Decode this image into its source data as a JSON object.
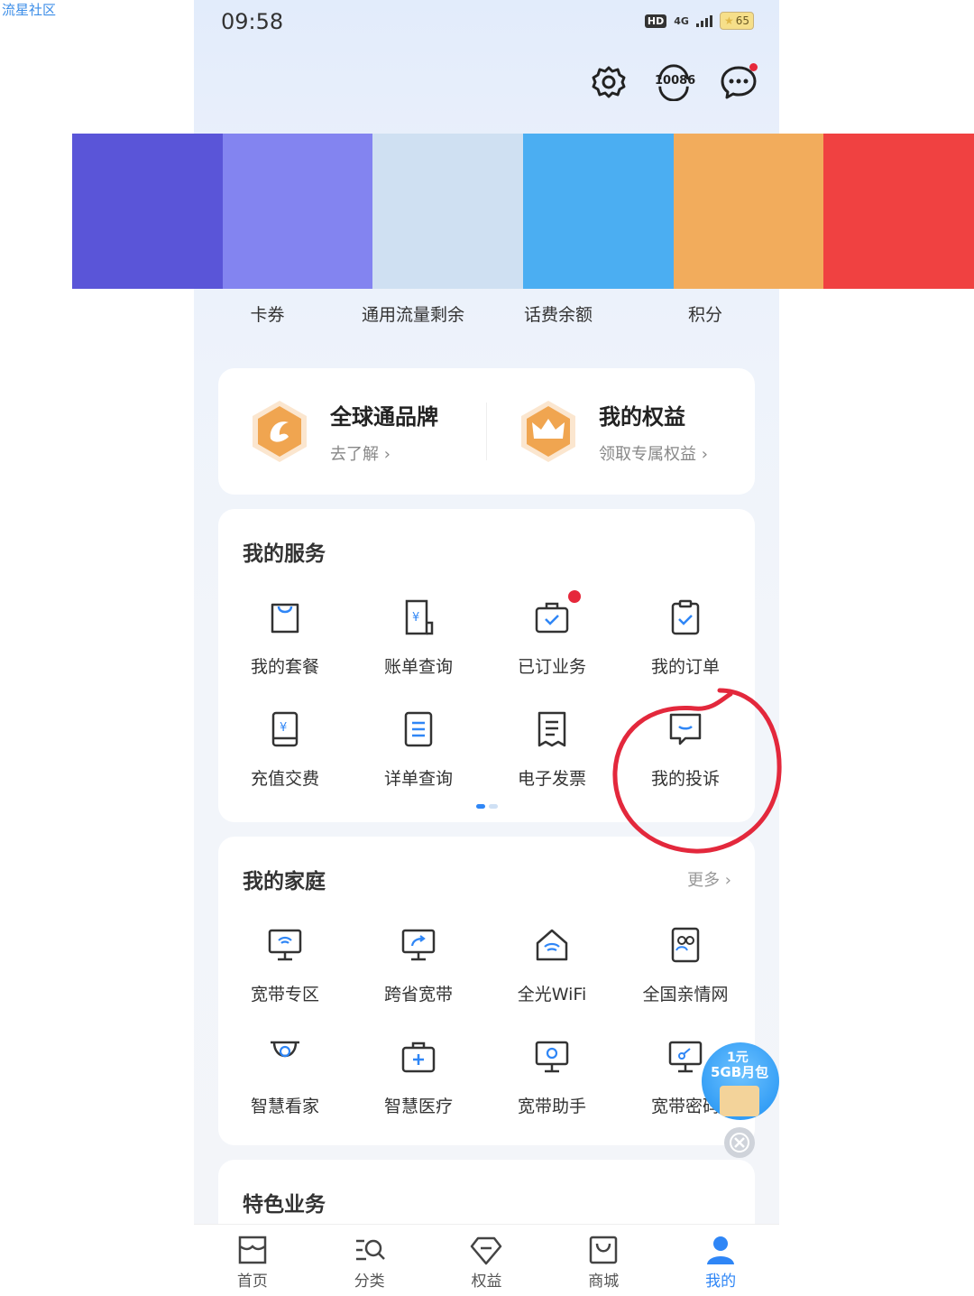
{
  "watermark": "流星社区",
  "status": {
    "time": "09:58",
    "hd": "HD",
    "network": "4G",
    "battery": "65"
  },
  "header_icons": [
    "gear-icon",
    "hotline-10086-icon",
    "message-icon"
  ],
  "hotline_number": "10086",
  "color_swatches": [
    "#5a55d8",
    "#8384f0",
    "#cfe0f2",
    "#4baef2",
    "#f2ac5c",
    "#f04141"
  ],
  "stats": [
    "卡券",
    "通用流量剩余",
    "话费余额",
    "积分"
  ],
  "brand": {
    "left": {
      "title": "全球通品牌",
      "sub": "去了解"
    },
    "right": {
      "title": "我的权益",
      "sub": "领取专属权益"
    }
  },
  "services": {
    "title": "我的服务",
    "items": [
      "我的套餐",
      "账单查询",
      "已订业务",
      "我的订单",
      "充值交费",
      "详单查询",
      "电子发票",
      "我的投诉"
    ]
  },
  "family": {
    "title": "我的家庭",
    "more": "更多",
    "items": [
      "宽带专区",
      "跨省宽带",
      "全光WiFi",
      "全国亲情网",
      "智慧看家",
      "智慧医疗",
      "宽带助手",
      "宽带密码"
    ]
  },
  "featured": {
    "title": "特色业务"
  },
  "promo": {
    "line1": "1元",
    "line2": "5GB月包"
  },
  "nav": {
    "items": [
      "首页",
      "分类",
      "权益",
      "商城",
      "我的"
    ],
    "active": "我的",
    "active_color": "#2f86f6"
  },
  "annotation_color": "#e3283c"
}
